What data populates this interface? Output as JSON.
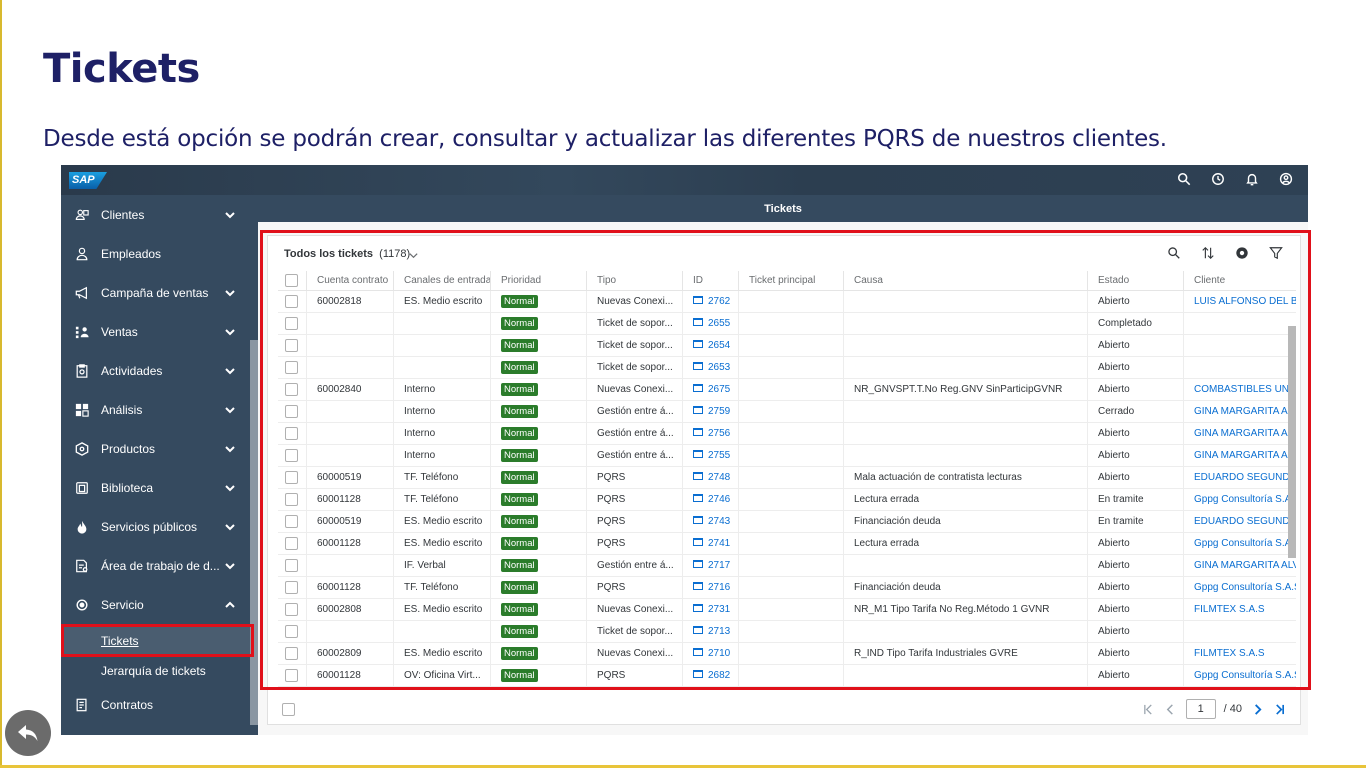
{
  "slide": {
    "title": "Tickets",
    "subtitle": "Desde está opción se podrán crear, consultar y actualizar las diferentes PQRS de nuestros clientes."
  },
  "shell": {
    "logo": "SAP",
    "icons": [
      "search-icon",
      "history-icon",
      "bell-icon",
      "user-icon"
    ]
  },
  "sidebar": {
    "items": [
      {
        "label": "Clientes",
        "icon": "customers-icon",
        "chevron": "down"
      },
      {
        "label": "Empleados",
        "icon": "employee-icon",
        "chevron": ""
      },
      {
        "label": "Campaña de ventas",
        "icon": "megaphone-icon",
        "chevron": "down"
      },
      {
        "label": "Ventas",
        "icon": "sales-icon",
        "chevron": "down"
      },
      {
        "label": "Actividades",
        "icon": "activities-icon",
        "chevron": "down"
      },
      {
        "label": "Análisis",
        "icon": "analytics-icon",
        "chevron": "down"
      },
      {
        "label": "Productos",
        "icon": "products-icon",
        "chevron": "down"
      },
      {
        "label": "Biblioteca",
        "icon": "library-icon",
        "chevron": "down"
      },
      {
        "label": "Servicios públicos",
        "icon": "utilities-icon",
        "chevron": "down"
      },
      {
        "label": "Área de trabajo de d...",
        "icon": "workspace-icon",
        "chevron": "down"
      },
      {
        "label": "Servicio",
        "icon": "service-icon",
        "chevron": "up"
      }
    ],
    "subitems": [
      {
        "label": "Tickets",
        "active": true
      },
      {
        "label": "Jerarquía de tickets",
        "active": false
      }
    ],
    "last_item": {
      "label": "Contratos",
      "icon": "contracts-icon"
    }
  },
  "page": {
    "title": "Tickets",
    "list_title": "Todos los tickets",
    "list_count": "(1178)"
  },
  "table": {
    "columns": [
      "Cuenta contrato",
      "Canales de entrada",
      "Prioridad",
      "Tipo",
      "ID",
      "Ticket principal",
      "Causa",
      "Estado",
      "Cliente"
    ],
    "rows": [
      [
        "60002818",
        "ES. Medio escrito",
        "Normal",
        "Nuevas Conexi...",
        "2762",
        "",
        "",
        "Abierto",
        "LUIS ALFONSO DEL BO"
      ],
      [
        "",
        "",
        "Normal",
        "Ticket de sopor...",
        "2655",
        "",
        "",
        "Completado",
        ""
      ],
      [
        "",
        "",
        "Normal",
        "Ticket de sopor...",
        "2654",
        "",
        "",
        "Abierto",
        ""
      ],
      [
        "",
        "",
        "Normal",
        "Ticket de sopor...",
        "2653",
        "",
        "",
        "Abierto",
        ""
      ],
      [
        "60002840",
        "Interno",
        "Normal",
        "Nuevas Conexi...",
        "2675",
        "",
        "NR_GNVSPT.T.No Reg.GNV SinParticipGVNR",
        "Abierto",
        "COMBASTIBLES UNIGA"
      ],
      [
        "",
        "Interno",
        "Normal",
        "Gestión entre á...",
        "2759",
        "",
        "",
        "Cerrado",
        "GINA MARGARITA ALVA"
      ],
      [
        "",
        "Interno",
        "Normal",
        "Gestión entre á...",
        "2756",
        "",
        "",
        "Abierto",
        "GINA MARGARITA ALVA"
      ],
      [
        "",
        "Interno",
        "Normal",
        "Gestión entre á...",
        "2755",
        "",
        "",
        "Abierto",
        "GINA MARGARITA ALVA"
      ],
      [
        "60000519",
        "TF. Teléfono",
        "Normal",
        "PQRS",
        "2748",
        "",
        "Mala actuación de contratista lecturas",
        "Abierto",
        "EDUARDO SEGUNDO P"
      ],
      [
        "60001128",
        "TF. Teléfono",
        "Normal",
        "PQRS",
        "2746",
        "",
        "Lectura errada",
        "En tramite",
        "Gppg Consultoría S.A.S"
      ],
      [
        "60000519",
        "ES. Medio escrito",
        "Normal",
        "PQRS",
        "2743",
        "",
        "Financiación deuda",
        "En tramite",
        "EDUARDO SEGUNDO P"
      ],
      [
        "60001128",
        "ES. Medio escrito",
        "Normal",
        "PQRS",
        "2741",
        "",
        "Lectura errada",
        "Abierto",
        "Gppg Consultoría S.A.S"
      ],
      [
        "",
        "IF. Verbal",
        "Normal",
        "Gestión entre á...",
        "2717",
        "",
        "",
        "Abierto",
        "GINA MARGARITA ALVA"
      ],
      [
        "60001128",
        "TF. Teléfono",
        "Normal",
        "PQRS",
        "2716",
        "",
        "Financiación deuda",
        "Abierto",
        "Gppg Consultoría S.A.S"
      ],
      [
        "60002808",
        "ES. Medio escrito",
        "Normal",
        "Nuevas Conexi...",
        "2731",
        "",
        "NR_M1 Tipo Tarifa No Reg.Método 1 GVNR",
        "Abierto",
        "FILMTEX S.A.S"
      ],
      [
        "",
        "",
        "Normal",
        "Ticket de sopor...",
        "2713",
        "",
        "",
        "Abierto",
        ""
      ],
      [
        "60002809",
        "ES. Medio escrito",
        "Normal",
        "Nuevas Conexi...",
        "2710",
        "",
        "R_IND Tipo Tarifa Industriales GVRE",
        "Abierto",
        "FILMTEX S.A.S"
      ],
      [
        "60001128",
        "OV: Oficina Virt...",
        "Normal",
        "PQRS",
        "2682",
        "",
        "",
        "Abierto",
        "Gppg Consultoría S.A.S"
      ]
    ]
  },
  "pager": {
    "page": "1",
    "total": "/ 40"
  },
  "colors": {
    "shell": "#354a5f",
    "priority_badge": "#2b7c2b",
    "link": "#0a6ed1",
    "highlight": "#e0101a",
    "title": "#1e2066"
  }
}
